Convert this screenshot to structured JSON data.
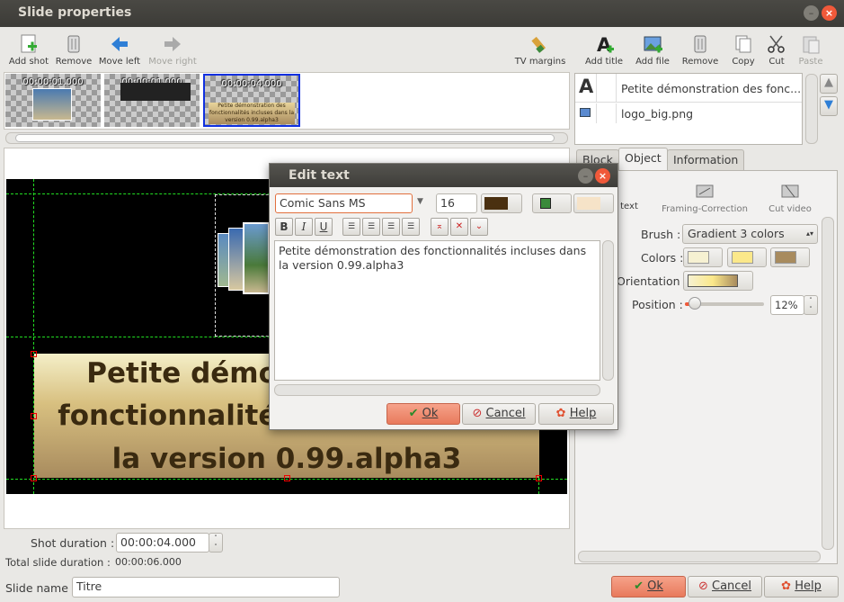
{
  "window": {
    "title": "Slide properties"
  },
  "toolbar_left": [
    {
      "label": "Add shot",
      "icon": "add-shot-icon",
      "enabled": true
    },
    {
      "label": "Remove",
      "icon": "trash-icon",
      "enabled": true
    },
    {
      "label": "Move left",
      "icon": "arrow-left-icon",
      "enabled": true
    },
    {
      "label": "Move right",
      "icon": "arrow-right-icon",
      "enabled": false
    }
  ],
  "tv_margins": {
    "label": "TV margins",
    "icon": "tv-margins-icon"
  },
  "toolbar_right": [
    {
      "label": "Add title",
      "icon": "add-title-icon",
      "enabled": true
    },
    {
      "label": "Add file",
      "icon": "add-file-icon",
      "enabled": true
    },
    {
      "label": "Remove",
      "icon": "trash-icon",
      "enabled": true
    },
    {
      "label": "Copy",
      "icon": "copy-icon",
      "enabled": true
    },
    {
      "label": "Cut",
      "icon": "scissors-icon",
      "enabled": true
    },
    {
      "label": "Paste",
      "icon": "paste-icon",
      "enabled": false
    }
  ],
  "shots": [
    {
      "time": "00:00:01.000",
      "selected": false
    },
    {
      "time": "00:00:01.000",
      "selected": false
    },
    {
      "time": "00:00:04.000",
      "selected": true,
      "caption": "Petite démonstration des fonctionnalités incluses dans la version 0.99.alpha3"
    }
  ],
  "blocks": [
    {
      "type_icon": "A",
      "name": "Petite démonstration des fonc..."
    },
    {
      "type_icon": "image-icon",
      "name": "logo_big.png"
    }
  ],
  "tabs": [
    {
      "label": "Block"
    },
    {
      "label": "Object"
    },
    {
      "label": "Information"
    }
  ],
  "subtools": [
    {
      "label": "text"
    },
    {
      "label": "Framing-Correction"
    },
    {
      "label": "Cut video"
    }
  ],
  "props": {
    "brush_label": "Brush :",
    "brush_value": "Gradient 3 colors",
    "colors_label": "Colors :",
    "colors": [
      "#f6f1d2",
      "#fbe88a",
      "#a88b5e"
    ],
    "orientation_label": "Orientation :",
    "position_label": "Position :",
    "position_value": "12%",
    "position_fraction": 0.12
  },
  "slide": {
    "text_lines": [
      "Petite démonstration des",
      "fonctionnalités incluses dans",
      "la version 0.99.alpha3"
    ]
  },
  "shot_duration_label": "Shot duration :",
  "shot_duration": "00:00:04.000",
  "total_duration_label": "Total slide duration :",
  "total_duration": "00:00:06.000",
  "slide_name_label": "Slide name :",
  "slide_name": "Titre",
  "buttons": {
    "ok": "Ok",
    "cancel": "Cancel",
    "help": "Help"
  },
  "dialog": {
    "title": "Edit text",
    "font": "Comic Sans MS",
    "size": "16",
    "text_color": "#4a3010",
    "bg_color": "#f6e3c8",
    "format_buttons": [
      "B",
      "I",
      "U"
    ],
    "text": "Petite démonstration des fonctionnalités incluses dans la version 0.99.alpha3",
    "ok": "Ok",
    "cancel": "Cancel",
    "help": "Help"
  }
}
